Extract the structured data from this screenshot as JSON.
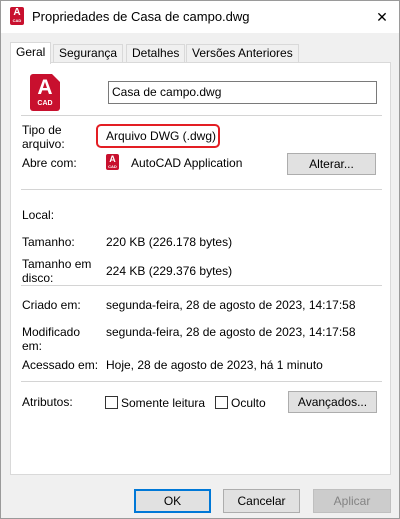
{
  "window": {
    "title": "Propriedades de Casa de campo.dwg",
    "close_glyph": "✕",
    "app_icon": {
      "letter": "A",
      "caption": "CAD",
      "color": "#c8102e"
    }
  },
  "tabs": [
    {
      "label": "Geral",
      "active": true
    },
    {
      "label": "Segurança",
      "active": false
    },
    {
      "label": "Detalhes",
      "active": false
    },
    {
      "label": "Versões Anteriores",
      "active": false
    }
  ],
  "general": {
    "file_name": "Casa de campo.dwg",
    "file_type_label": "Tipo de arquivo:",
    "file_type_value": "Arquivo DWG (.dwg)",
    "open_with_label": "Abre com:",
    "open_with_value": "AutoCAD Application",
    "change_button": "Alterar...",
    "location_label": "Local:",
    "location_value": "",
    "size_label": "Tamanho:",
    "size_value": "220 KB (226.178 bytes)",
    "size_on_disk_label": "Tamanho em disco:",
    "size_on_disk_value": "224 KB (229.376 bytes)",
    "created_label": "Criado em:",
    "created_value": "segunda-feira, 28 de agosto de 2023, 14:17:58",
    "modified_label": "Modificado em:",
    "modified_value": "segunda-feira, 28 de agosto de 2023, 14:17:58",
    "accessed_label": "Acessado em:",
    "accessed_value": "Hoje, 28 de agosto de 2023, há 1 minuto",
    "attributes_label": "Atributos:",
    "readonly_label": "Somente leitura",
    "readonly_checked": false,
    "hidden_label": "Oculto",
    "hidden_checked": false,
    "advanced_button": "Avançados..."
  },
  "footer": {
    "ok": "OK",
    "cancel": "Cancelar",
    "apply": "Aplicar"
  },
  "colors": {
    "accent": "#0078d7",
    "highlight_border": "#e31e24",
    "autocad_red": "#c8102e"
  }
}
